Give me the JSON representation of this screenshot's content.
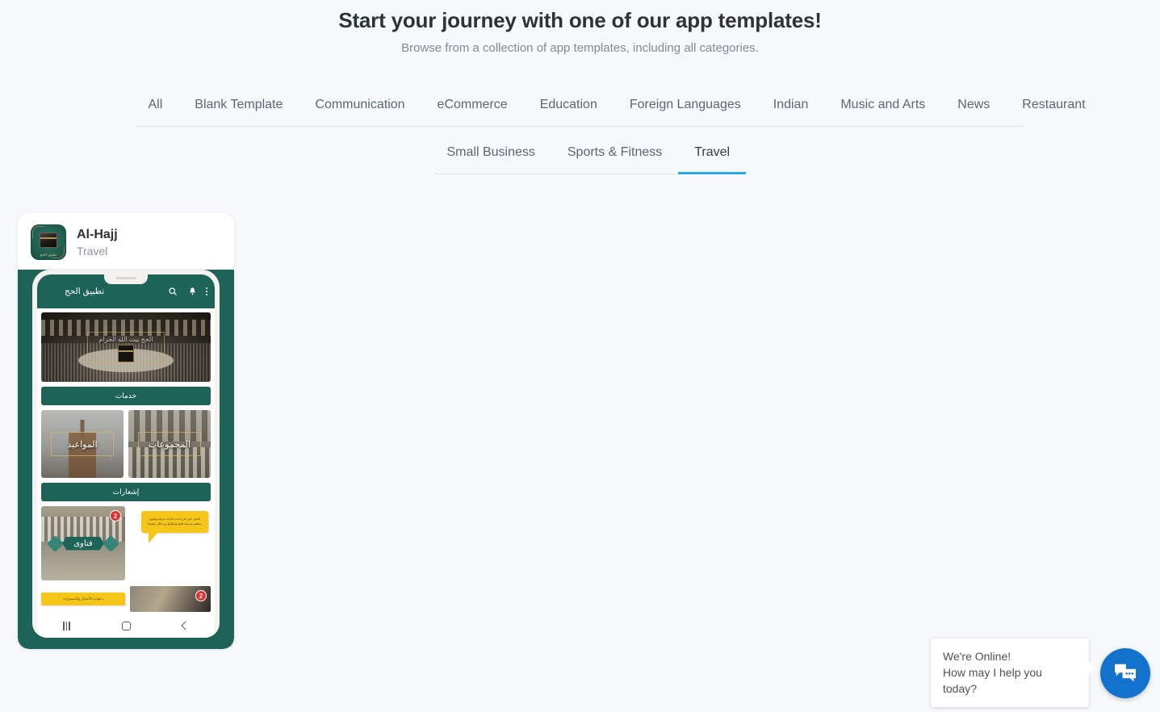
{
  "header": {
    "title": "Start your journey with one of our app templates!",
    "subtitle": "Browse from a collection of app templates, including all categories."
  },
  "tabs": {
    "row1": [
      {
        "label": "All",
        "active": false
      },
      {
        "label": "Blank Template",
        "active": false
      },
      {
        "label": "Communication",
        "active": false
      },
      {
        "label": "eCommerce",
        "active": false
      },
      {
        "label": "Education",
        "active": false
      },
      {
        "label": "Foreign Languages",
        "active": false
      },
      {
        "label": "Indian",
        "active": false
      },
      {
        "label": "Music and Arts",
        "active": false
      },
      {
        "label": "News",
        "active": false
      },
      {
        "label": "Restaurant",
        "active": false
      }
    ],
    "row2": [
      {
        "label": "Small Business",
        "active": false
      },
      {
        "label": "Sports & Fitness",
        "active": false
      },
      {
        "label": "Travel",
        "active": true
      }
    ],
    "active_color": "#29abe2"
  },
  "templates": [
    {
      "title": "Al-Hajj",
      "category": "Travel",
      "icon_label": "تطبيق الحج",
      "accent_color": "#1d6357",
      "preview": {
        "appbar_title": "تطبيق الحج",
        "hero_caption": "الحج بيت الله الحرام",
        "services_bar": "خدمات",
        "notifications_bar": "إشعارات",
        "tiles": [
          {
            "label": "المواعيد"
          },
          {
            "label": "المجموعات"
          }
        ],
        "fatwa_tile": {
          "label": "فتاوى",
          "badge": "2"
        },
        "speech_bubble": "احصل على اخر احدث احداث عرفية وفتاوى منطقة بمدينتك الحج وإمكانها من خلال تطبيقنا",
        "yellow_label": "دعوات الأعمال والمسيرات",
        "second_badge": "2"
      }
    }
  ],
  "chat": {
    "line1": "We're Online!",
    "line2": "How may I help you today?",
    "fab_color": "#1272cc",
    "fab_icon": "chat-bubbles-icon"
  }
}
